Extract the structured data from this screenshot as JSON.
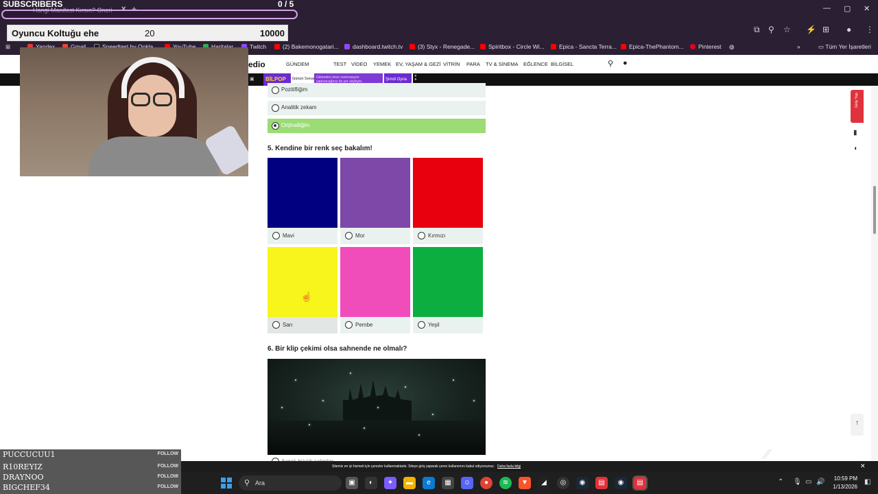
{
  "overlay": {
    "subs_label": "SUBSCRIBERS",
    "subs_count": "0  / 5",
    "goal_label": "Oyuncu Koltuğu ehe",
    "goal_current": "20",
    "goal_target": "10000",
    "chat": [
      {
        "name": "PUCCUCUU1",
        "follow": "FOLLOW"
      },
      {
        "name": "R10REYIZ",
        "follow": "FOLLOW"
      },
      {
        "name": "DRAYNOO",
        "follow": "FOLLOW"
      },
      {
        "name": "BIGCHEF34",
        "follow": "FOLLOW"
      }
    ]
  },
  "browser": {
    "tab_title": "Hangi Manifest Kırsın?  Oneri",
    "bookmarks": [
      {
        "label": "Yandex",
        "color": "#e03b2e"
      },
      {
        "label": "Gmail",
        "color": "#e94335"
      },
      {
        "label": "Speedtest by Ookla...",
        "color": "#1b1b1b"
      },
      {
        "label": "YouTube",
        "color": "#ff0000"
      },
      {
        "label": "Haritalar",
        "color": "#34a853"
      },
      {
        "label": "Twitch",
        "color": "#9146ff"
      },
      {
        "label": "(2) Bakemonogatari...",
        "color": "#ff0000"
      },
      {
        "label": "dashboard.twitch.tv",
        "color": "#9146ff"
      },
      {
        "label": "(3) Styx - Renegade...",
        "color": "#ff0000"
      },
      {
        "label": "Spiritbox - Circle Wi...",
        "color": "#ff0000"
      },
      {
        "label": "Epica - Sancta Terra...",
        "color": "#ff0000"
      },
      {
        "label": "Epica-ThePhantom...",
        "color": "#ff0000"
      },
      {
        "label": "Pinterest",
        "color": "#e60023"
      }
    ],
    "all_bookmarks": "Tüm Yer İşaretleri"
  },
  "site": {
    "logo": "edio",
    "nav": [
      "GÜNDEM",
      "TEST",
      "VİDEO",
      "YEMEK",
      "EV, YAŞAM & GEZİ",
      "VİTRİN",
      "PARA",
      "TV & SİNEMA",
      "EĞLENCE",
      "BİLGİSEL"
    ],
    "promo": {
      "logo": "BİLPOP",
      "sub": "Günün Sorusu",
      "text": "Gitmeden önce rezervasyon yaptıracağınız bir yer söyleyin.",
      "play": "Şimdi Oyna"
    },
    "side_tab": "Giriş Yap"
  },
  "quiz": {
    "prev_options": [
      {
        "label": "Pozitifliğim",
        "selected": false
      },
      {
        "label": "Analitik zekam",
        "selected": false
      },
      {
        "label": "Orijinalliğim",
        "selected": true
      }
    ],
    "q5_title": "5. Kendine bir renk seç bakalım!",
    "colors": [
      {
        "label": "Mavi",
        "color": "#000080"
      },
      {
        "label": "Mor",
        "color": "#7d48a8"
      },
      {
        "label": "Kırmızı",
        "color": "#e8000f"
      },
      {
        "label": "Sarı",
        "color": "#f7f51c"
      },
      {
        "label": "Pembe",
        "color": "#f04dbb"
      },
      {
        "label": "Yeşil",
        "color": "#0cae3f"
      }
    ],
    "q6_title": "6. Bir klip çekimi olsa sahnende ne olmalı?",
    "q6_first_option": "Aynalı büyük salonlar"
  },
  "cookie": {
    "text": "Sitemiz en iyi hizmeti için çerezler kullanmaktadır. Siteye giriş yaparak çerez kullanımını kabul ediyorsunuz.",
    "link": "Daha fazla bilgi"
  },
  "taskbar": {
    "search_placeholder": "Ara",
    "time": "10:59 PM",
    "date": "1/13/2026"
  }
}
